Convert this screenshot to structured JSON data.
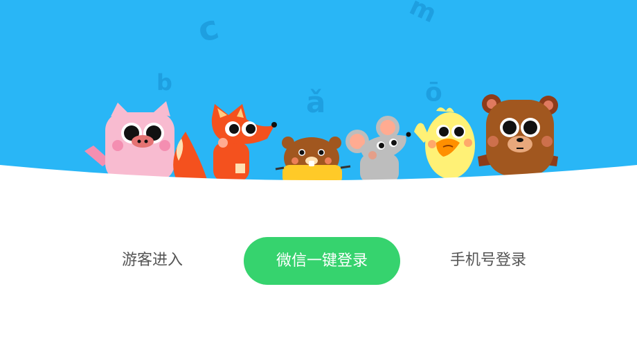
{
  "hero": {
    "sky_color": "#29b6f6",
    "floating_letters": [
      "c",
      "m",
      "b",
      "ǎ",
      "ō"
    ],
    "characters": [
      "pig",
      "fox",
      "bear-cub",
      "mouse",
      "duck",
      "bear"
    ]
  },
  "actions": {
    "guest_label": "游客进入",
    "wechat_label": "微信一键登录",
    "phone_label": "手机号登录"
  },
  "colors": {
    "wechat_button": "#36d36e",
    "text_secondary": "#555555"
  }
}
